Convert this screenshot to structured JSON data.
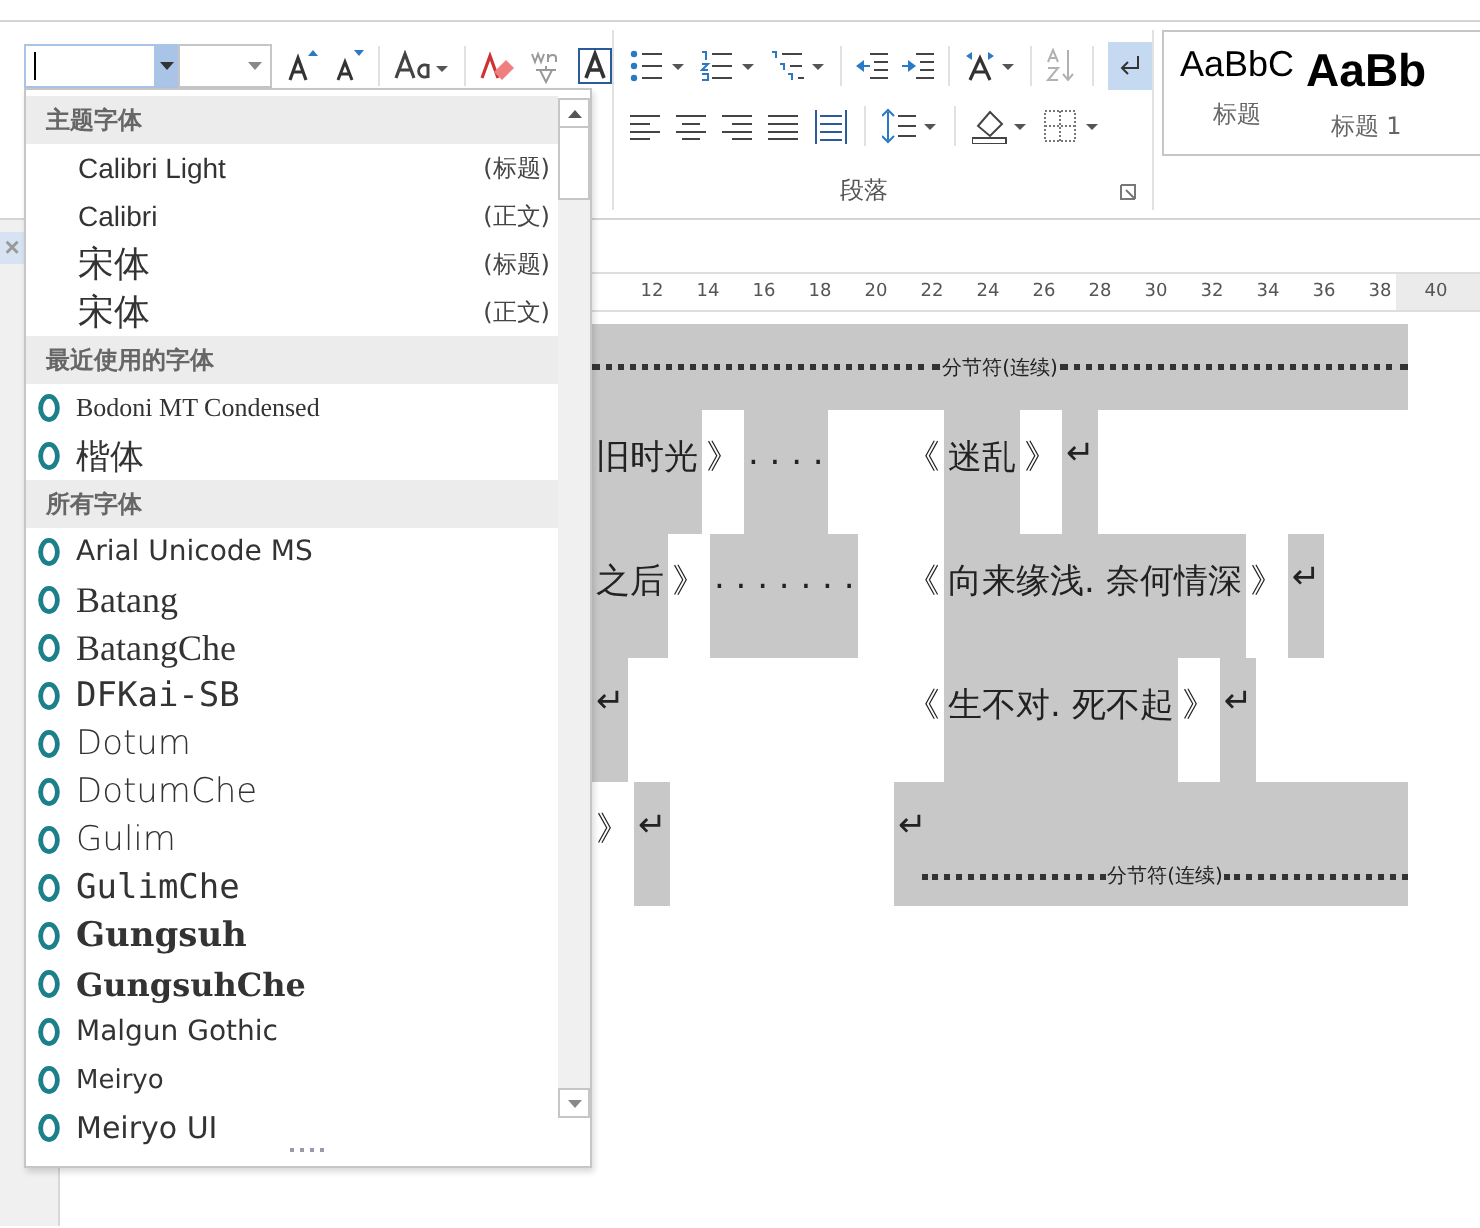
{
  "font_group": {
    "font_name": {
      "dropdown_pressed": true
    }
  },
  "paragraph_group": {
    "label": "段落",
    "sort": {
      "disabled": true
    },
    "show_marks": {
      "on": true
    }
  },
  "styles": [
    {
      "sample": "AaBbC",
      "name": "标题"
    },
    {
      "sample": "AaBb",
      "name": "标题 1"
    }
  ],
  "nav_pane": {
    "close": "×"
  },
  "ruler": {
    "ticks": [
      "12",
      "14",
      "16",
      "18",
      "20",
      "22",
      "24",
      "26",
      "28",
      "30",
      "32",
      "34",
      "36",
      "38",
      "40"
    ]
  },
  "document": {
    "rows": [
      {
        "kind": "section_break",
        "label": "分节符(连续)"
      },
      {
        "kind": "line",
        "left": [
          {
            "text": "旧时光",
            "shaded": true
          },
          {
            "text": "》",
            "shaded": false
          },
          {
            "text": ". . . .",
            "shaded": true
          }
        ],
        "right": [
          {
            "text": "《",
            "shaded": false
          },
          {
            "text": "迷乱",
            "shaded": true
          },
          {
            "text": "》",
            "shaded": false
          },
          {
            "text": "↵",
            "shaded": true
          }
        ]
      },
      {
        "kind": "line",
        "left": [
          {
            "text": "之后",
            "shaded": true
          },
          {
            "text": "》",
            "shaded": false
          },
          {
            "text": ". . . . . . .",
            "shaded": true
          }
        ],
        "right": [
          {
            "text": "《",
            "shaded": false
          },
          {
            "text": "向来缘浅. 奈何情深",
            "shaded": true
          },
          {
            "text": "》",
            "shaded": false
          },
          {
            "text": "↵",
            "shaded": true
          }
        ]
      },
      {
        "kind": "line",
        "left": [
          {
            "text": "↵",
            "shaded": true
          }
        ],
        "right": [
          {
            "text": "《",
            "shaded": false
          },
          {
            "text": "生不对. 死不起",
            "shaded": true
          },
          {
            "text": "》",
            "shaded": false
          },
          {
            "text": "↵",
            "shaded": true
          }
        ]
      },
      {
        "kind": "line",
        "left": [
          {
            "text": "》",
            "shaded": false
          },
          {
            "text": "↵",
            "shaded": true
          }
        ],
        "right": [
          {
            "text": "↵"
          }
        ],
        "section_break": "分节符(连续)"
      }
    ]
  },
  "font_dropdown": {
    "sections": [
      {
        "kind": "theme",
        "title": "主题字体",
        "items": [
          {
            "name": "Calibri Light",
            "tag": "(标题)"
          },
          {
            "name": "Calibri",
            "tag": "(正文)"
          },
          {
            "name": "宋体",
            "tag": "(标题)"
          },
          {
            "name": "宋体",
            "tag": "(正文)"
          }
        ]
      },
      {
        "kind": "fonts",
        "title": "最近使用的字体",
        "items": [
          {
            "name": "Bodoni MT Condensed"
          },
          {
            "name": "楷体"
          }
        ]
      },
      {
        "kind": "fonts",
        "title": "所有字体",
        "items": [
          {
            "name": "Arial Unicode MS"
          },
          {
            "name": "Batang"
          },
          {
            "name": "BatangChe"
          },
          {
            "name": "DFKai-SB"
          },
          {
            "name": "Dotum"
          },
          {
            "name": "DotumChe"
          },
          {
            "name": "Gulim"
          },
          {
            "name": "GulimChe"
          },
          {
            "name": "Gungsuh"
          },
          {
            "name": "GungsuhChe"
          },
          {
            "name": "Malgun Gothic"
          },
          {
            "name": "Meiryo"
          },
          {
            "name": "Meiryo UI"
          }
        ]
      }
    ]
  }
}
